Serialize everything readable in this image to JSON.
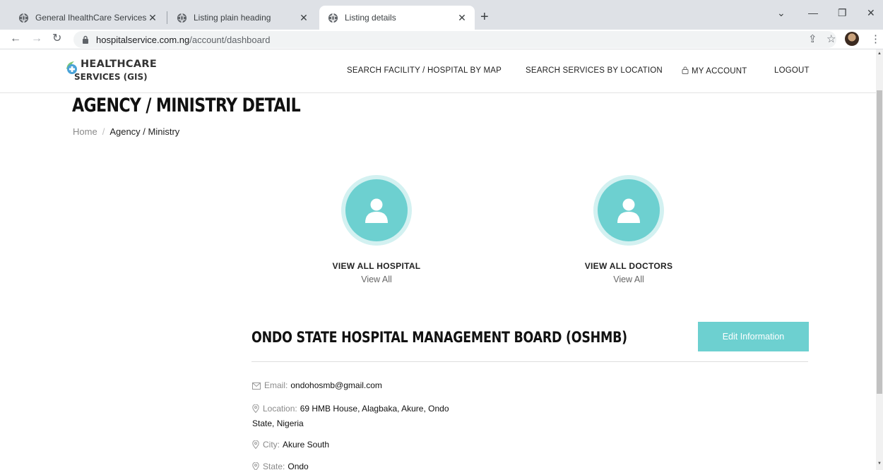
{
  "browser": {
    "tabs": [
      {
        "title": "General IhealthCare Services",
        "active": false
      },
      {
        "title": "Listing plain heading",
        "active": false
      },
      {
        "title": "Listing details",
        "active": true
      }
    ],
    "url_host": "hospitalservice.com.ng",
    "url_path": "/account/dashboard"
  },
  "header": {
    "logo_line1": "HEALTHCARE",
    "logo_line2": "SERVICES (GIS)",
    "nav": [
      {
        "label": "SEARCH FACILITY / HOSPITAL BY MAP"
      },
      {
        "label": "SEARCH SERVICES BY LOCATION"
      },
      {
        "label": "MY ACCOUNT",
        "icon": "lock-icon"
      },
      {
        "label": "LOGOUT"
      }
    ]
  },
  "page": {
    "title": "AGENCY / MINISTRY DETAIL",
    "breadcrumb": {
      "home": "Home",
      "separator": "/",
      "current": "Agency / Ministry"
    }
  },
  "stats": [
    {
      "label": "VIEW ALL HOSPITAL",
      "link": "View All",
      "icon": "user-icon"
    },
    {
      "label": "VIEW ALL DOCTORS",
      "link": "View All",
      "icon": "user-icon"
    }
  ],
  "agency": {
    "name": "ONDO STATE HOSPITAL MANAGEMENT BOARD (OSHMB)",
    "edit_button": "Edit Information",
    "email_label": "Email:",
    "email": "ondohosmb@gmail.com",
    "location_label": "Location:",
    "location_line1": "69 HMB House, Alagbaka, Akure, Ondo",
    "location_line2": "State, Nigeria",
    "city_label": "City:",
    "city": "Akure South",
    "state_label": "State:",
    "state": "Ondo"
  },
  "colors": {
    "accent": "#6dd0d0",
    "accent_ring": "#d3f1f1",
    "tabbar": "#dee1e6"
  }
}
